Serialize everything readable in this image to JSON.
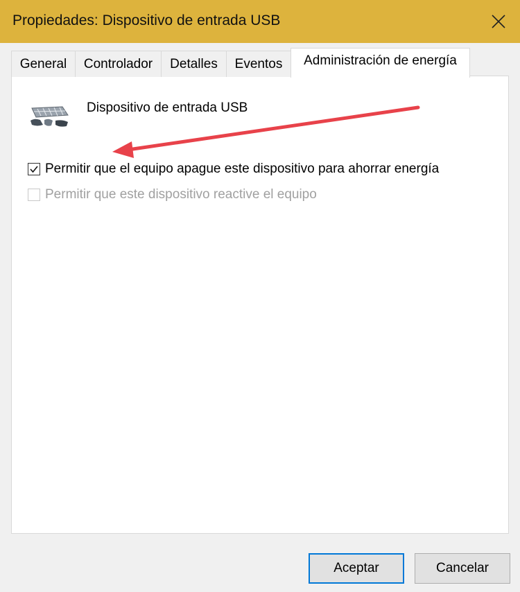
{
  "window": {
    "title": "Propiedades: Dispositivo de entrada USB",
    "accent_color": "#ddb33d",
    "close_icon": "close-icon"
  },
  "tabs": [
    {
      "label": "General",
      "active": false
    },
    {
      "label": "Controlador",
      "active": false
    },
    {
      "label": "Detalles",
      "active": false
    },
    {
      "label": "Eventos",
      "active": false
    },
    {
      "label": "Administración de energía",
      "active": true
    }
  ],
  "device": {
    "name": "Dispositivo de entrada USB",
    "icon": "usb-device-icon"
  },
  "options": [
    {
      "label": "Permitir que el equipo apague este dispositivo para ahorrar energía",
      "checked": true,
      "enabled": true
    },
    {
      "label": "Permitir que este dispositivo reactive el equipo",
      "checked": false,
      "enabled": false
    }
  ],
  "annotation": {
    "arrow_color": "#e8424a"
  },
  "buttons": {
    "ok": "Aceptar",
    "cancel": "Cancelar"
  }
}
